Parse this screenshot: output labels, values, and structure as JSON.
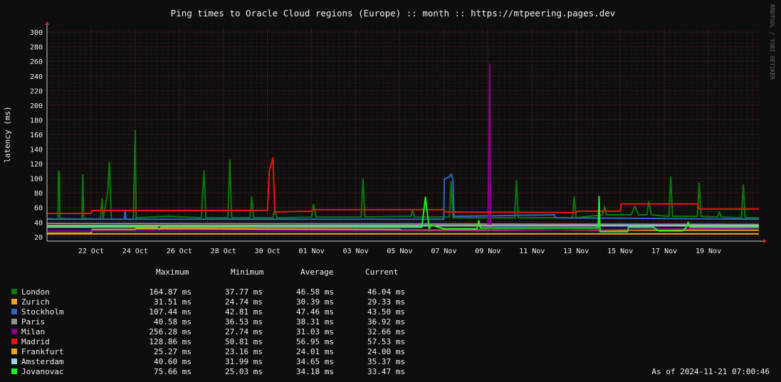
{
  "chart_data": {
    "type": "line",
    "title": "Ping times to Oracle Cloud regions (Europe) :: month :: https://mtpeering.pages.dev",
    "ylabel": "latency (ms)",
    "xlabel": "",
    "ylim": [
      14,
      304
    ],
    "y_ticks": [
      20,
      40,
      60,
      80,
      100,
      120,
      140,
      160,
      180,
      200,
      220,
      240,
      260,
      280,
      300
    ],
    "x_range": [
      "2024-10-20",
      "2024-11-21"
    ],
    "x_ticks": [
      {
        "date": "2024-10-22",
        "label": "22 Oct"
      },
      {
        "date": "2024-10-24",
        "label": "24 Oct"
      },
      {
        "date": "2024-10-26",
        "label": "26 Oct"
      },
      {
        "date": "2024-10-28",
        "label": "28 Oct"
      },
      {
        "date": "2024-10-30",
        "label": "30 Oct"
      },
      {
        "date": "2024-11-01",
        "label": "01 Nov"
      },
      {
        "date": "2024-11-03",
        "label": "03 Nov"
      },
      {
        "date": "2024-11-05",
        "label": "05 Nov"
      },
      {
        "date": "2024-11-07",
        "label": "07 Nov"
      },
      {
        "date": "2024-11-09",
        "label": "09 Nov"
      },
      {
        "date": "2024-11-11",
        "label": "11 Nov"
      },
      {
        "date": "2024-11-13",
        "label": "13 Nov"
      },
      {
        "date": "2024-11-15",
        "label": "15 Nov"
      },
      {
        "date": "2024-11-17",
        "label": "17 Nov"
      },
      {
        "date": "2024-11-19",
        "label": "19 Nov"
      }
    ],
    "grid": true,
    "legend_placement": "bottom",
    "series": [
      {
        "name": "London",
        "color": "#0a7a0a",
        "points": [
          [
            "2024-10-20T00:00",
            45
          ],
          [
            "2024-10-20T12:00",
            44
          ],
          [
            "2024-10-20T12:30",
            110
          ],
          [
            "2024-10-20T13:30",
            107
          ],
          [
            "2024-10-20T14:00",
            45
          ],
          [
            "2024-10-21T14:00",
            44
          ],
          [
            "2024-10-21T15:00",
            105
          ],
          [
            "2024-10-21T16:00",
            45
          ],
          [
            "2024-10-22T10:00",
            44
          ],
          [
            "2024-10-22T12:00",
            72
          ],
          [
            "2024-10-22T13:00",
            44
          ],
          [
            "2024-10-22T18:00",
            80
          ],
          [
            "2024-10-22T20:00",
            122
          ],
          [
            "2024-10-22T22:00",
            44
          ],
          [
            "2024-10-23T22:00",
            44
          ],
          [
            "2024-10-24T00:00",
            165
          ],
          [
            "2024-10-24T01:00",
            46
          ],
          [
            "2024-10-25T12:00",
            48
          ],
          [
            "2024-10-27T00:00",
            46
          ],
          [
            "2024-10-27T03:00",
            110
          ],
          [
            "2024-10-27T05:00",
            46
          ],
          [
            "2024-10-28T05:00",
            46
          ],
          [
            "2024-10-28T07:00",
            125
          ],
          [
            "2024-10-28T09:00",
            46
          ],
          [
            "2024-10-29T05:00",
            46
          ],
          [
            "2024-10-29T07:00",
            74
          ],
          [
            "2024-10-29T09:00",
            46
          ],
          [
            "2024-10-30T06:00",
            46
          ],
          [
            "2024-10-30T08:00",
            58
          ],
          [
            "2024-10-30T10:00",
            46
          ],
          [
            "2024-11-01T00:00",
            47
          ],
          [
            "2024-11-01T02:00",
            64
          ],
          [
            "2024-11-01T05:00",
            47
          ],
          [
            "2024-11-03T06:00",
            47
          ],
          [
            "2024-11-03T08:00",
            99
          ],
          [
            "2024-11-03T10:00",
            47
          ],
          [
            "2024-11-05T12:00",
            48
          ],
          [
            "2024-11-05T14:00",
            56
          ],
          [
            "2024-11-05T16:00",
            47
          ],
          [
            "2024-11-07T06:00",
            47
          ],
          [
            "2024-11-07T08:00",
            95
          ],
          [
            "2024-11-07T10:00",
            46
          ],
          [
            "2024-11-10T05:00",
            46
          ],
          [
            "2024-11-10T07:00",
            97
          ],
          [
            "2024-11-10T09:00",
            46
          ],
          [
            "2024-11-12T20:00",
            46
          ],
          [
            "2024-11-12T22:00",
            74
          ],
          [
            "2024-11-13T00:00",
            46
          ],
          [
            "2024-11-14T05:00",
            50
          ],
          [
            "2024-11-14T07:00",
            62
          ],
          [
            "2024-11-14T09:00",
            50
          ],
          [
            "2024-11-15T12:00",
            50
          ],
          [
            "2024-11-15T16:00",
            62
          ],
          [
            "2024-11-15T20:00",
            50
          ],
          [
            "2024-11-16T05:00",
            50
          ],
          [
            "2024-11-16T07:00",
            68
          ],
          [
            "2024-11-16T10:00",
            50
          ],
          [
            "2024-11-17T05:00",
            48
          ],
          [
            "2024-11-17T07:00",
            102
          ],
          [
            "2024-11-17T09:00",
            48
          ],
          [
            "2024-11-18T12:00",
            48
          ],
          [
            "2024-11-18T14:00",
            93
          ],
          [
            "2024-11-18T16:00",
            48
          ],
          [
            "2024-11-19T10:00",
            47
          ],
          [
            "2024-11-19T12:00",
            54
          ],
          [
            "2024-11-19T14:00",
            47
          ],
          [
            "2024-11-20T12:00",
            46
          ],
          [
            "2024-11-20T14:00",
            91
          ],
          [
            "2024-11-20T16:00",
            46
          ],
          [
            "2024-11-21T07:00",
            46
          ]
        ]
      },
      {
        "name": "Zurich",
        "color": "#f5a31a",
        "points": [
          [
            "2024-10-20T00:00",
            25
          ],
          [
            "2024-10-22T00:00",
            25
          ],
          [
            "2024-10-22T01:00",
            30
          ],
          [
            "2024-10-24T00:00",
            30
          ],
          [
            "2024-10-24T01:00",
            31
          ],
          [
            "2024-11-05T00:00",
            30
          ],
          [
            "2024-11-05T02:00",
            29
          ],
          [
            "2024-11-21T07:00",
            29
          ]
        ]
      },
      {
        "name": "Stockholm",
        "color": "#2f66c4",
        "points": [
          [
            "2024-10-20T00:00",
            44
          ],
          [
            "2024-10-23T12:00",
            44
          ],
          [
            "2024-10-23T13:00",
            55
          ],
          [
            "2024-10-23T14:00",
            44
          ],
          [
            "2024-11-07T00:00",
            44
          ],
          [
            "2024-11-07T00:30",
            99
          ],
          [
            "2024-11-07T06:00",
            102
          ],
          [
            "2024-11-07T08:00",
            106
          ],
          [
            "2024-11-07T10:00",
            98
          ],
          [
            "2024-11-07T11:00",
            48
          ],
          [
            "2024-11-12T00:00",
            50
          ],
          [
            "2024-11-12T02:00",
            46
          ],
          [
            "2024-11-21T07:00",
            44
          ]
        ]
      },
      {
        "name": "Paris",
        "color": "#909090",
        "points": [
          [
            "2024-10-20T00:00",
            38
          ],
          [
            "2024-11-21T07:00",
            37
          ]
        ]
      },
      {
        "name": "Milan",
        "color": "#8a008a",
        "points": [
          [
            "2024-10-20T00:00",
            28
          ],
          [
            "2024-11-09T00:00",
            28
          ],
          [
            "2024-11-09T02:00",
            256
          ],
          [
            "2024-11-09T03:00",
            28
          ],
          [
            "2024-11-21T07:00",
            32
          ]
        ]
      },
      {
        "name": "Madrid",
        "color": "#ee1111",
        "points": [
          [
            "2024-10-20T00:00",
            52
          ],
          [
            "2024-10-22T00:00",
            52
          ],
          [
            "2024-10-22T01:00",
            56
          ],
          [
            "2024-10-24T00:00",
            56
          ],
          [
            "2024-10-24T02:00",
            56
          ],
          [
            "2024-10-30T00:00",
            56
          ],
          [
            "2024-10-30T02:00",
            110
          ],
          [
            "2024-10-30T06:00",
            128
          ],
          [
            "2024-10-30T08:00",
            54
          ],
          [
            "2024-11-01T00:00",
            55
          ],
          [
            "2024-11-01T01:00",
            57
          ],
          [
            "2024-11-07T00:00",
            57
          ],
          [
            "2024-11-07T02:00",
            54
          ],
          [
            "2024-11-13T00:00",
            53
          ],
          [
            "2024-11-13T01:00",
            55
          ],
          [
            "2024-11-15T00:00",
            55
          ],
          [
            "2024-11-15T01:00",
            65
          ],
          [
            "2024-11-18T12:00",
            65
          ],
          [
            "2024-11-18T14:00",
            58
          ],
          [
            "2024-11-21T07:00",
            58
          ]
        ]
      },
      {
        "name": "Frankfurt",
        "color": "#f7a31c",
        "points": [
          [
            "2024-10-20T00:00",
            24
          ],
          [
            "2024-11-21T07:00",
            24
          ]
        ]
      },
      {
        "name": "Amsterdam",
        "color": "#9ed2e8",
        "points": [
          [
            "2024-10-20T00:00",
            35
          ],
          [
            "2024-11-21T07:00",
            35
          ]
        ]
      },
      {
        "name": "Jovanovac",
        "color": "#22ee22",
        "points": [
          [
            "2024-10-20T00:00",
            33
          ],
          [
            "2024-10-25T00:00",
            33
          ],
          [
            "2024-10-25T02:00",
            30
          ],
          [
            "2024-10-25T04:00",
            33
          ],
          [
            "2024-11-06T00:00",
            33
          ],
          [
            "2024-11-06T04:00",
            74
          ],
          [
            "2024-11-06T08:00",
            31
          ],
          [
            "2024-11-06T10:00",
            36
          ],
          [
            "2024-11-07T00:00",
            31
          ],
          [
            "2024-11-08T12:00",
            31
          ],
          [
            "2024-11-08T14:00",
            42
          ],
          [
            "2024-11-08T16:00",
            32
          ],
          [
            "2024-11-14T00:00",
            32
          ],
          [
            "2024-11-14T01:00",
            75
          ],
          [
            "2024-11-14T02:00",
            27
          ],
          [
            "2024-11-15T08:00",
            27
          ],
          [
            "2024-11-15T09:00",
            33
          ],
          [
            "2024-11-16T12:00",
            33
          ],
          [
            "2024-11-16T18:00",
            28
          ],
          [
            "2024-11-17T20:00",
            28
          ],
          [
            "2024-11-18T00:00",
            33
          ],
          [
            "2024-11-18T02:00",
            40
          ],
          [
            "2024-11-18T04:00",
            33
          ],
          [
            "2024-11-21T07:00",
            33
          ]
        ]
      }
    ]
  },
  "legend": {
    "headers": {
      "maximum": "Maximum",
      "minimum": "Minimum",
      "average": "Average",
      "current": "Current"
    },
    "rows": [
      {
        "name": "London",
        "color": "#0a7a0a",
        "max": "164.87 ms",
        "min": "37.77 ms",
        "avg": "46.58 ms",
        "cur": "46.04 ms"
      },
      {
        "name": "Zurich",
        "color": "#f5a31a",
        "max": "31.51 ms",
        "min": "24.74 ms",
        "avg": "30.39 ms",
        "cur": "29.33 ms"
      },
      {
        "name": "Stockholm",
        "color": "#2f66c4",
        "max": "107.44 ms",
        "min": "42.81 ms",
        "avg": "47.46 ms",
        "cur": "43.50 ms"
      },
      {
        "name": "Paris",
        "color": "#909090",
        "max": "40.58 ms",
        "min": "36.53 ms",
        "avg": "38.31 ms",
        "cur": "36.92 ms"
      },
      {
        "name": "Milan",
        "color": "#8a008a",
        "max": "256.28 ms",
        "min": "27.74 ms",
        "avg": "31.03 ms",
        "cur": "32.66 ms"
      },
      {
        "name": "Madrid",
        "color": "#ee1111",
        "max": "128.86 ms",
        "min": "50.81 ms",
        "avg": "56.95 ms",
        "cur": "57.53 ms"
      },
      {
        "name": "Frankfurt",
        "color": "#f7a31c",
        "max": "25.27 ms",
        "min": "23.16 ms",
        "avg": "24.01 ms",
        "cur": "24.00 ms"
      },
      {
        "name": "Amsterdam",
        "color": "#9ed2e8",
        "max": "40.60 ms",
        "min": "31.99 ms",
        "avg": "34.65 ms",
        "cur": "35.37 ms"
      },
      {
        "name": "Jovanovac",
        "color": "#22ee22",
        "max": "75.66 ms",
        "min": "25.03 ms",
        "avg": "34.18 ms",
        "cur": "33.47 ms"
      }
    ]
  },
  "timestamp": "As of 2024-11-21 07:00:46",
  "side_label": "RRDTOOL / TOBI OETIKER"
}
